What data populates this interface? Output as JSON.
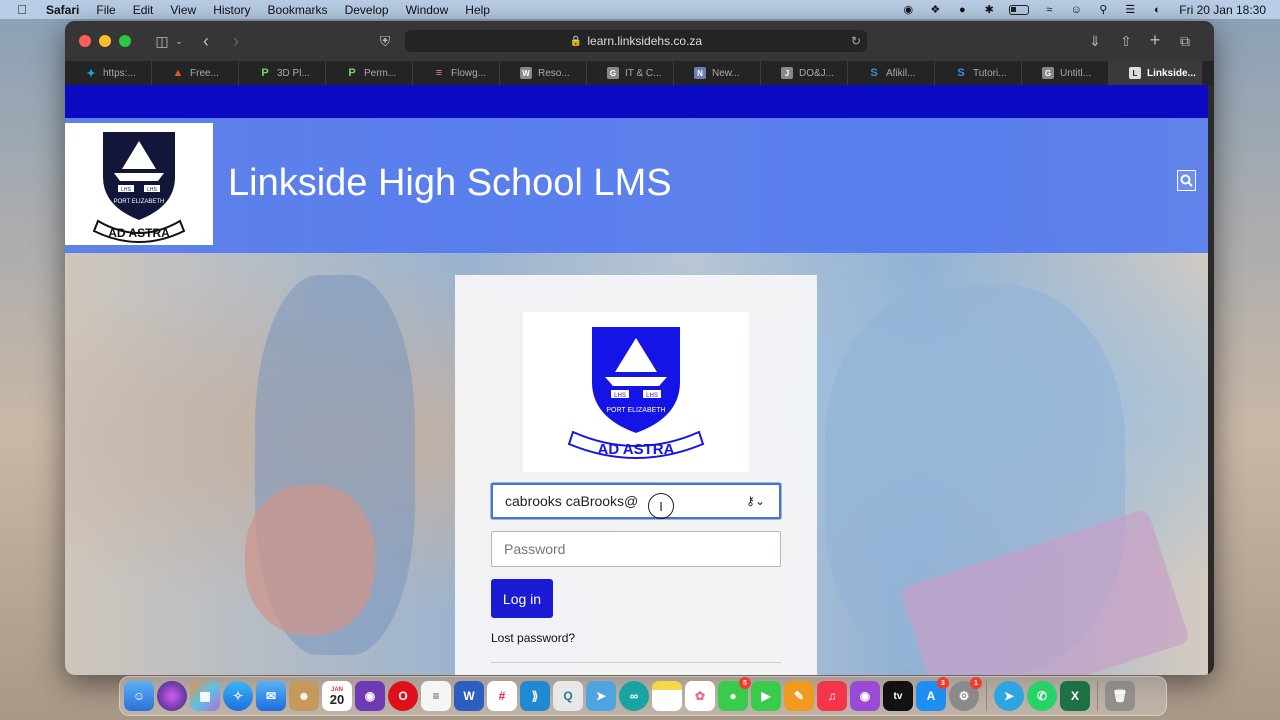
{
  "menubar": {
    "items": [
      "Safari",
      "File",
      "Edit",
      "View",
      "History",
      "Bookmarks",
      "Develop",
      "Window",
      "Help"
    ],
    "clock": "Fri 20 Jan  18:30"
  },
  "browser": {
    "url": "learn.linksidehs.co.za",
    "tabs": [
      {
        "label": "https:...",
        "icon": "twitter-icon",
        "color": "#1da1f2",
        "glyph": "t"
      },
      {
        "label": "Free...",
        "icon": "flame-icon",
        "color": "#e8521f",
        "glyph": "F"
      },
      {
        "label": "3D Pl...",
        "icon": "p-icon",
        "color": "#5cb85c",
        "glyph": "P"
      },
      {
        "label": "Perm...",
        "icon": "p-icon",
        "color": "#5cb85c",
        "glyph": "P"
      },
      {
        "label": "Flowg...",
        "icon": "flowgorithm-icon",
        "color": "#c94f4f",
        "glyph": "S"
      },
      {
        "label": "Reso...",
        "icon": "w-icon",
        "color": "#888888",
        "glyph": "W"
      },
      {
        "label": "IT & C...",
        "icon": "g-icon",
        "color": "#888888",
        "glyph": "G"
      },
      {
        "label": "New...",
        "icon": "doc-icon",
        "color": "#6a7fb5",
        "glyph": "N"
      },
      {
        "label": "DO&J...",
        "icon": "j-icon",
        "color": "#888888",
        "glyph": "J"
      },
      {
        "label": "Afikil...",
        "icon": "s-icon",
        "color": "#3a8de0",
        "glyph": "S"
      },
      {
        "label": "Tutori...",
        "icon": "s-icon",
        "color": "#3a8de0",
        "glyph": "S"
      },
      {
        "label": "Untitl...",
        "icon": "g-icon",
        "color": "#888888",
        "glyph": "G"
      },
      {
        "label": "Linkside...",
        "icon": "l-icon",
        "color": "#dddddd",
        "glyph": "L"
      }
    ]
  },
  "site": {
    "title": "Linkside High School LMS",
    "crest_motto": "AD ASTRA",
    "crest_city": "PORT ELIZABETH",
    "crest_initials": "LHS"
  },
  "login": {
    "username_value": "cabrooks caBrooks@",
    "password_placeholder": "Password",
    "login_button": "Log in",
    "lost_password": "Lost password?"
  },
  "dock": {
    "calendar_month": "JAN",
    "calendar_day": "20",
    "badges": {
      "messages": "5",
      "appstore": "3",
      "settings": "1"
    }
  },
  "colors": {
    "accent": "#1b1bd6",
    "banner": "#5078f0",
    "top_strip": "#0b0bc4"
  }
}
